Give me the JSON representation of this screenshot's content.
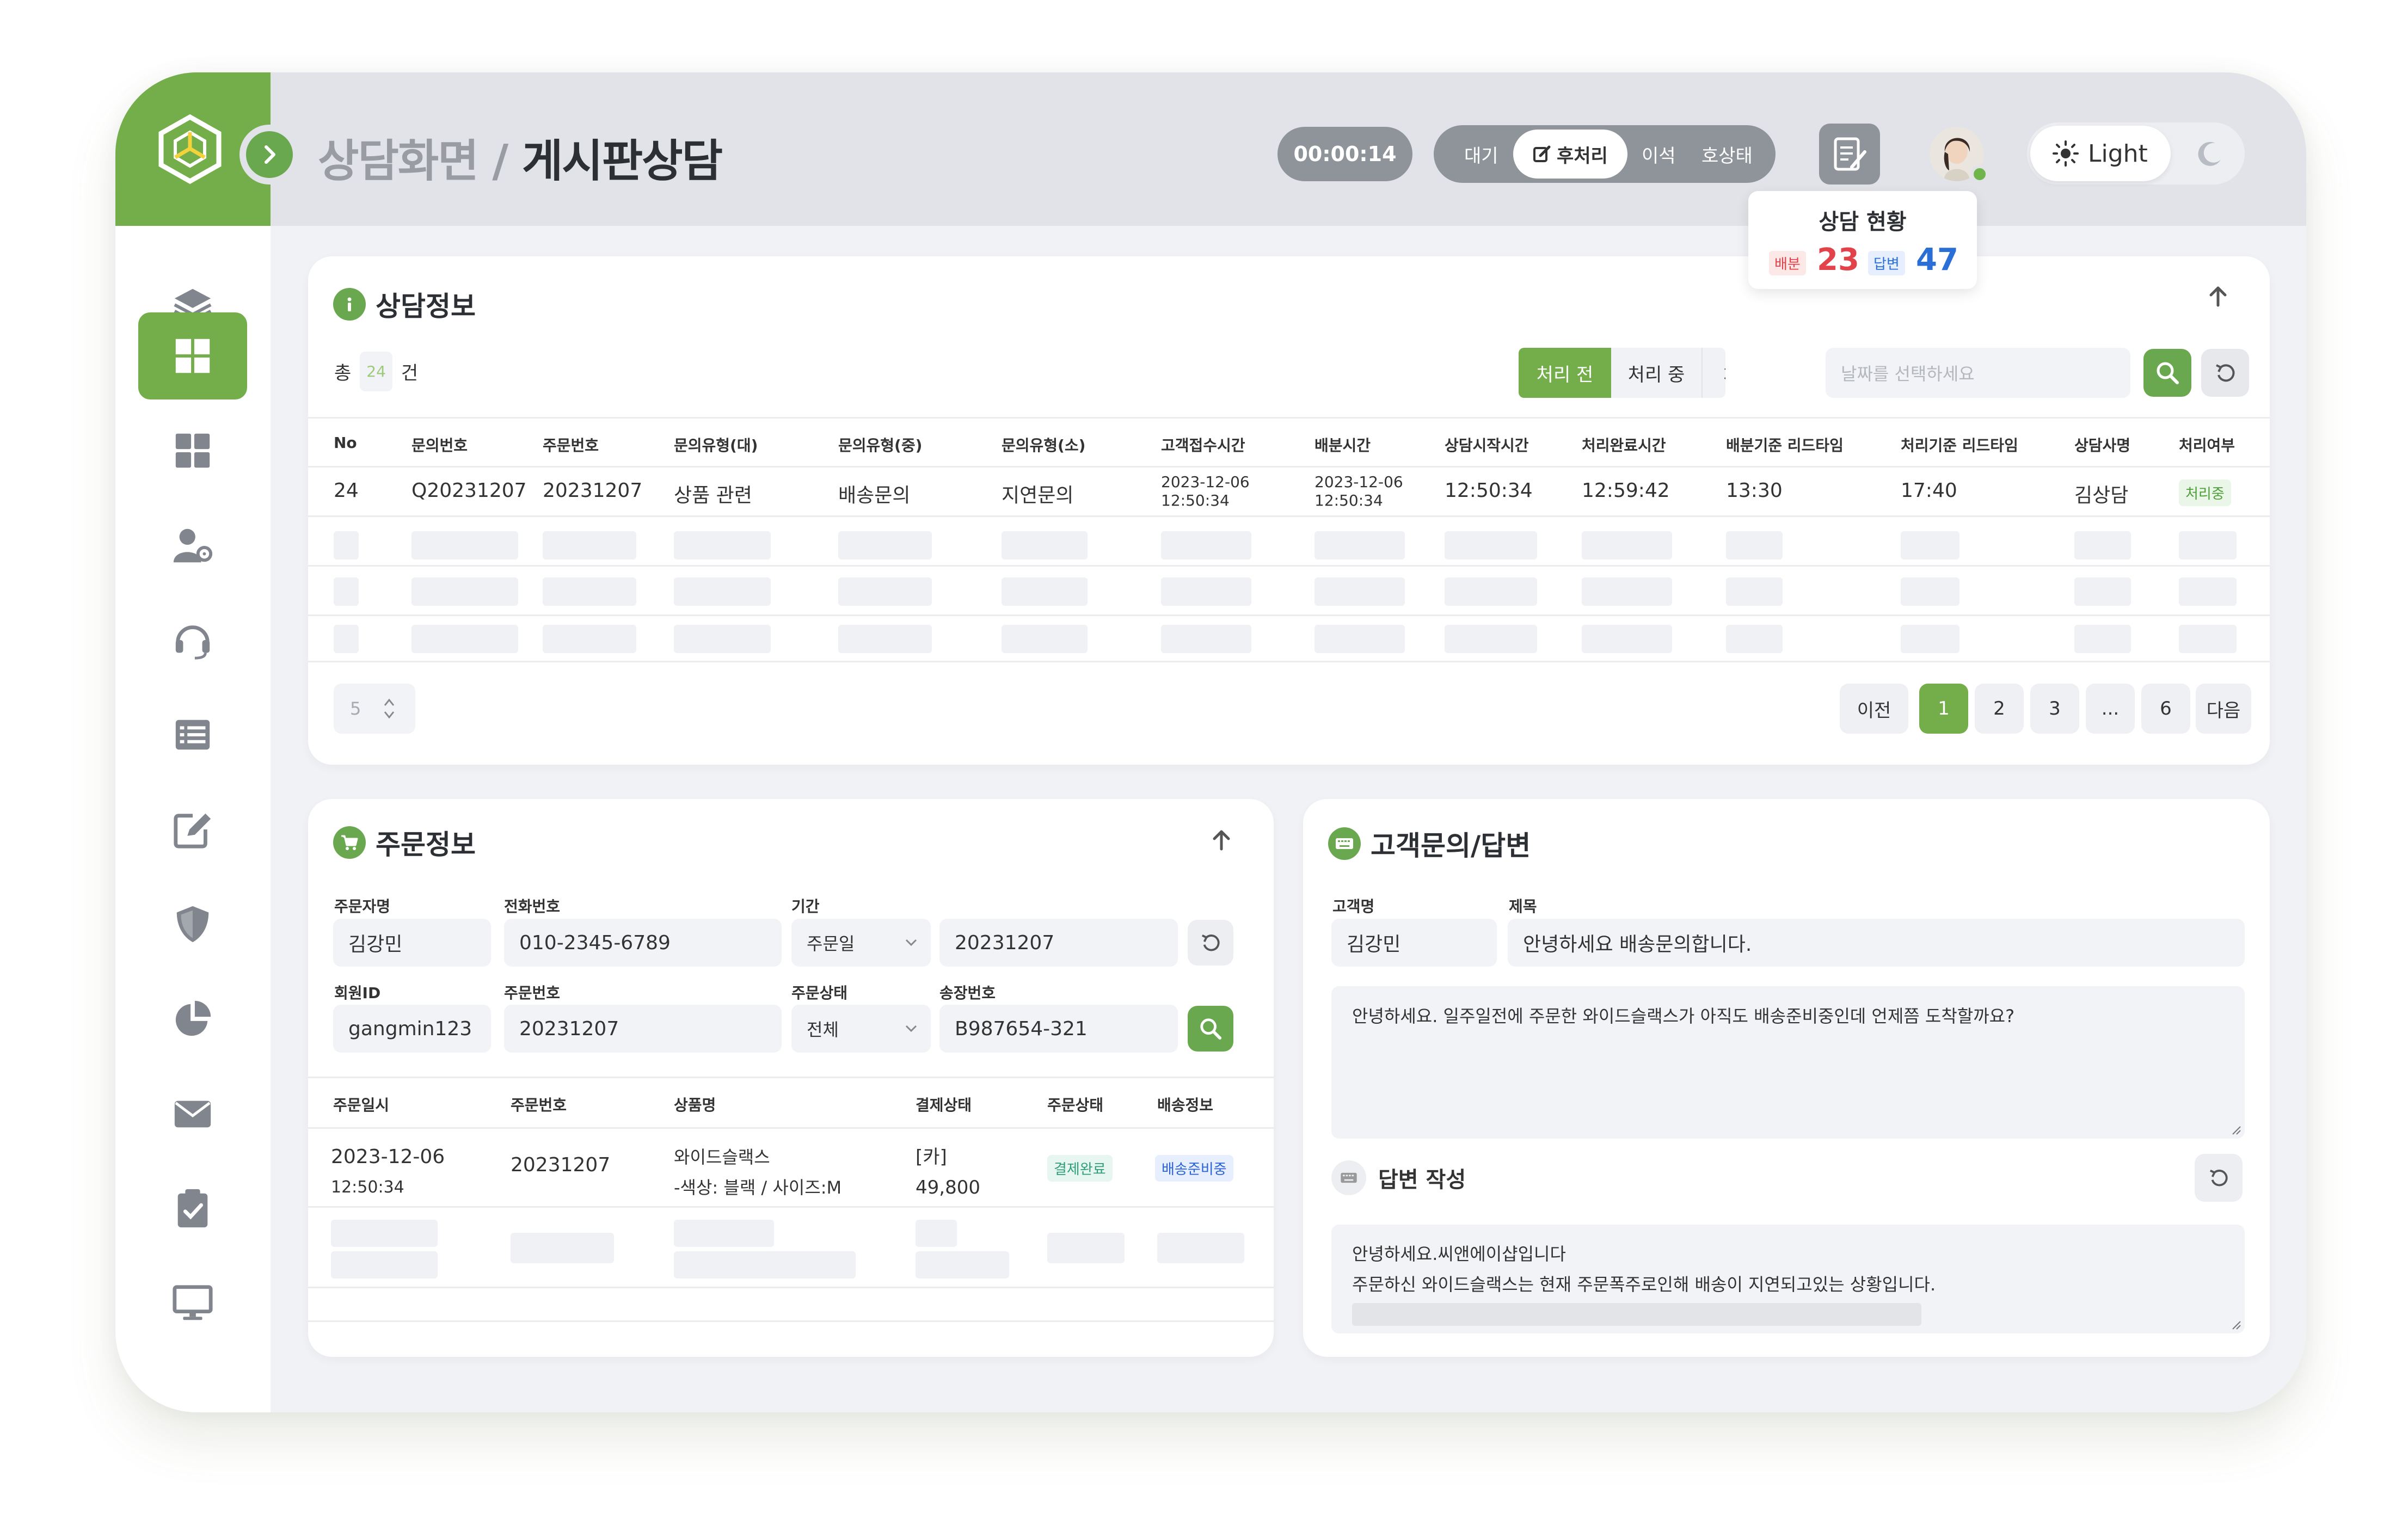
{
  "header": {
    "breadcrumb_parent": "상담화면 /",
    "breadcrumb_current": "게시판상담",
    "timer": "00:00:14",
    "status_options": [
      "대기",
      "후처리",
      "이석",
      "호상태"
    ],
    "status_selected": "후처리",
    "theme_label": "Light"
  },
  "popover": {
    "title": "상담 현황",
    "assign_label": "배분",
    "assign_count": "23",
    "answer_label": "답변",
    "answer_count": "47"
  },
  "sidebar": {
    "items": [
      "layers-icon",
      "dashboard-icon",
      "grid-icon",
      "user-settings-icon",
      "headset-icon",
      "list-icon",
      "edit-icon",
      "shield-icon",
      "pie-chart-icon",
      "mail-icon",
      "clipboard-check-icon",
      "monitor-icon"
    ],
    "active_index": 1
  },
  "consult": {
    "title": "상담정보",
    "total_prefix": "총",
    "total_count": "24",
    "total_suffix": "건",
    "filters": [
      "처리 전",
      "처리 중",
      "처리 완료"
    ],
    "date_placeholder": "날짜를 선택하세요",
    "columns": [
      "No",
      "문의번호",
      "주문번호",
      "문의유형(대)",
      "문의유형(중)",
      "문의유형(소)",
      "고객접수시간",
      "배분시간",
      "상담시작시간",
      "처리완료시간",
      "배분기준 리드타임",
      "처리기준 리드타임",
      "상담사명",
      "처리여부"
    ],
    "row": {
      "no": "24",
      "inquiry_no": "Q20231207",
      "order_no": "20231207",
      "type_l": "상품 관련",
      "type_m": "배송문의",
      "type_s": "지연문의",
      "received_date": "2023-12-06",
      "received_time": "12:50:34",
      "assigned_date": "2023-12-06",
      "assigned_time": "12:50:34",
      "start_time": "12:50:34",
      "end_time": "12:59:42",
      "lead_assign": "13:30",
      "lead_process": "17:40",
      "agent": "김상담",
      "state": "처리중"
    },
    "page_size": "5",
    "pagination": [
      "이전",
      "1",
      "2",
      "3",
      "...",
      "6",
      "다음"
    ],
    "current_page": "1"
  },
  "order": {
    "title": "주문정보",
    "labels": {
      "orderer": "주문자명",
      "phone": "전화번호",
      "period": "기간",
      "member_id": "회원ID",
      "order_no": "주문번호",
      "order_status": "주문상태",
      "invoice": "송장번호"
    },
    "values": {
      "orderer": "김강민",
      "phone": "010-2345-6789",
      "period_type": "주문일",
      "period_date": "20231207",
      "member_id": "gangmin123",
      "order_no": "20231207",
      "order_status": "전체",
      "invoice": "B987654-321"
    },
    "columns": [
      "주문일시",
      "주문번호",
      "상품명",
      "결제상태",
      "주문상태",
      "배송정보"
    ],
    "row": {
      "date": "2023-12-06",
      "time": "12:50:34",
      "order_no": "20231207",
      "product_line1": "와이드슬랙스",
      "product_line2": "-색상: 블랙 / 사이즈:M",
      "payment_method": "[카]",
      "payment_amount": "49,800",
      "order_state": "결제완료",
      "delivery_state": "배송준비중"
    }
  },
  "inquiry": {
    "title": "고객문의/답변",
    "customer_label": "고객명",
    "subject_label": "제목",
    "customer": "김강민",
    "subject": "안녕하세요 배송문의합니다.",
    "body": "안녕하세요. 일주일전에 주문한 와이드슬랙스가 아직도 배송준비중인데 언제쯤 도착할까요?",
    "answer_title": "답변 작성",
    "answer_line1": "안녕하세요.씨앤에이샵입니다",
    "answer_line2": "주문하신 와이드슬랙스는 현재 주문폭주로인해 배송이 지연되고있는 상황입니다."
  },
  "colors": {
    "brand_green": "#74ae4a",
    "count_red": "#e2434b",
    "count_blue": "#2a6fd6"
  }
}
